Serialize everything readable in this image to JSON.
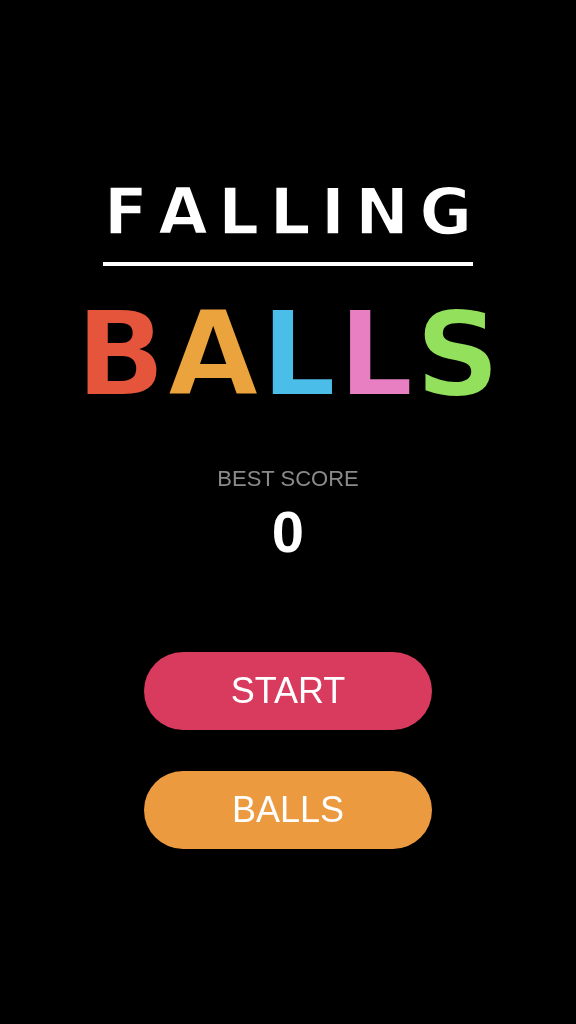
{
  "logo": {
    "title": "FALLING",
    "letters": [
      {
        "text": "B",
        "color": "#e5553b"
      },
      {
        "text": "A",
        "color": "#eba43d"
      },
      {
        "text": "L",
        "color": "#4bbde9"
      },
      {
        "text": "L",
        "color": "#e97fc3"
      },
      {
        "text": "S",
        "color": "#92e05b"
      }
    ]
  },
  "best_score": {
    "label": "BEST SCORE",
    "value": "0"
  },
  "buttons": [
    {
      "label": "START",
      "color": "#d93b5f"
    },
    {
      "label": "BALLS",
      "color": "#eb9a40"
    }
  ]
}
